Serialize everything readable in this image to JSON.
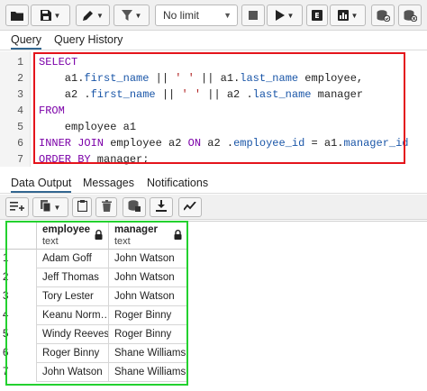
{
  "toolbar": {
    "limit_select_value": "No limit",
    "buttons": [
      {
        "name": "open-file-button",
        "icon": "folder-icon"
      },
      {
        "name": "save-file-button",
        "icon": "save-icon"
      },
      {
        "name": "edit-button",
        "icon": "pencil-icon"
      },
      {
        "name": "filter-button",
        "icon": "filter-icon"
      },
      {
        "name": "stop-button",
        "icon": "stop-icon"
      },
      {
        "name": "execute-button",
        "icon": "play-icon"
      },
      {
        "name": "explain-button",
        "icon": "explain-icon"
      },
      {
        "name": "explain-analyze-button",
        "icon": "chart-icon"
      },
      {
        "name": "commit-button",
        "icon": "database-commit-icon"
      },
      {
        "name": "rollback-button",
        "icon": "database-rollback-icon"
      }
    ]
  },
  "query_tabs": [
    {
      "label": "Query",
      "active": true
    },
    {
      "label": "Query History",
      "active": false
    }
  ],
  "editor": {
    "line_numbers": [
      "1",
      "2",
      "3",
      "4",
      "5",
      "6",
      "7"
    ]
  },
  "output_tabs": [
    {
      "label": "Data Output",
      "active": true
    },
    {
      "label": "Messages",
      "active": false
    },
    {
      "label": "Notifications",
      "active": false
    }
  ],
  "grid": {
    "columns": [
      {
        "name": "employee",
        "type": "text"
      },
      {
        "name": "manager",
        "type": "text"
      }
    ],
    "rows": [
      {
        "num": "1",
        "employee": "Adam Goff",
        "manager": "John Watson"
      },
      {
        "num": "2",
        "employee": "Jeff Thomas",
        "manager": "John Watson"
      },
      {
        "num": "3",
        "employee": "Tory Lester",
        "manager": "John Watson"
      },
      {
        "num": "4",
        "employee": "Keanu Norm…",
        "manager": "Roger Binny"
      },
      {
        "num": "5",
        "employee": "Windy Reeves",
        "manager": "Roger Binny"
      },
      {
        "num": "6",
        "employee": "Roger Binny",
        "manager": "Shane Williams"
      },
      {
        "num": "7",
        "employee": "John Watson",
        "manager": "Shane Williams"
      }
    ]
  },
  "colors": {
    "sql_highlight_box": "#e4141b",
    "result_highlight_box": "#23d12f",
    "keyword": "#7b00a8",
    "column_ref": "#1a56a8",
    "string_literal": "#b02020"
  }
}
